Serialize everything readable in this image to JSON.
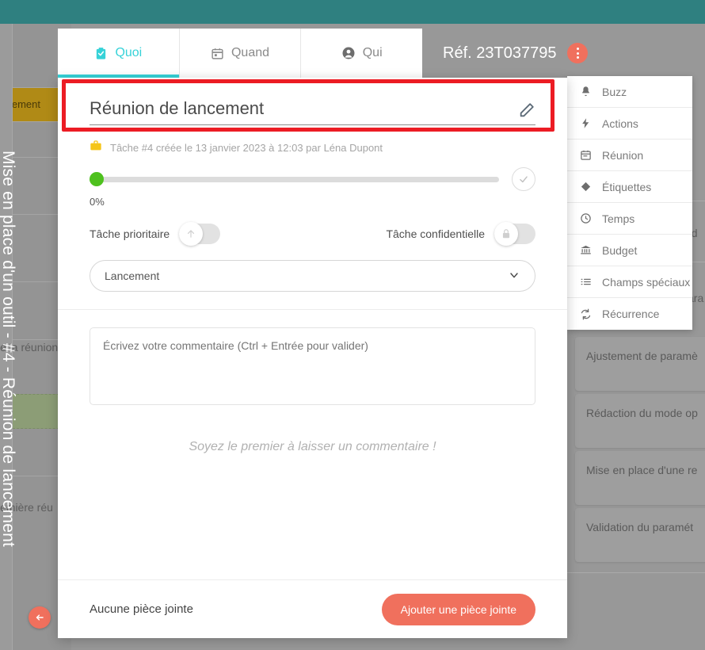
{
  "theme": {
    "topbar_color": "#2f8080",
    "accent_color": "#36d2d8",
    "primary_button_color": "#f0705d",
    "highlight_box_color": "#ec1c24",
    "progress_knob_color": "#4ec11e",
    "gold_row_color": "#b08a16",
    "green_row_color": "#8c9d76"
  },
  "background": {
    "side_title": "Mise en place d'un outil - #4 - Réunion de lancement",
    "gold_row_label": "lancement",
    "left_texts": [
      "e la réunion",
      "emière réu"
    ],
    "back_button_icon": "arrow-left-icon",
    "cards": [
      {
        "label": "Ajustement de paramè"
      },
      {
        "label": "Rédaction du mode op"
      },
      {
        "label": "Mise en place d'une re"
      },
      {
        "label": "Validation du paramét"
      }
    ],
    "right_fragments": [
      "el d",
      "ara"
    ]
  },
  "modal": {
    "tabs": [
      {
        "label": "Quoi",
        "icon": "clipboard-check-icon",
        "active": true
      },
      {
        "label": "Quand",
        "icon": "calendar-icon",
        "active": false
      },
      {
        "label": "Qui",
        "icon": "user-circle-icon",
        "active": false
      }
    ],
    "reference": "Réf. 23T037795",
    "kebab_icon": "more-vertical-icon",
    "title": "Réunion de lancement",
    "title_edit_icon": "pencil-icon",
    "meta": {
      "icon": "briefcase-icon",
      "text": "Tâche #4 créée le 13 janvier 2023 à 12:03 par Léna Dupont"
    },
    "progress": {
      "value": 0,
      "label": "0%",
      "confirm_icon": "check-icon"
    },
    "switches": [
      {
        "label": "Tâche prioritaire",
        "icon": "arrow-up-icon",
        "on": false
      },
      {
        "label": "Tâche confidentielle",
        "icon": "lock-icon",
        "on": false
      }
    ],
    "select": {
      "value": "Lancement",
      "chevron_icon": "chevron-down-icon"
    },
    "comment": {
      "placeholder": "Écrivez votre commentaire (Ctrl + Entrée pour valider)",
      "value": "",
      "empty_state": "Soyez le premier à laisser un commentaire !"
    },
    "footer": {
      "attachment_status": "Aucune pièce jointe",
      "add_attachment_label": "Ajouter une pièce jointe"
    }
  },
  "side_menu": {
    "items": [
      {
        "label": "Buzz",
        "icon": "bell-icon"
      },
      {
        "label": "Actions",
        "icon": "bolt-icon"
      },
      {
        "label": "Réunion",
        "icon": "calendar-icon"
      },
      {
        "label": "Étiquettes",
        "icon": "tag-icon"
      },
      {
        "label": "Temps",
        "icon": "clock-icon"
      },
      {
        "label": "Budget",
        "icon": "bank-icon"
      },
      {
        "label": "Champs spéciaux",
        "icon": "list-icon"
      },
      {
        "label": "Récurrence",
        "icon": "refresh-icon"
      }
    ]
  }
}
